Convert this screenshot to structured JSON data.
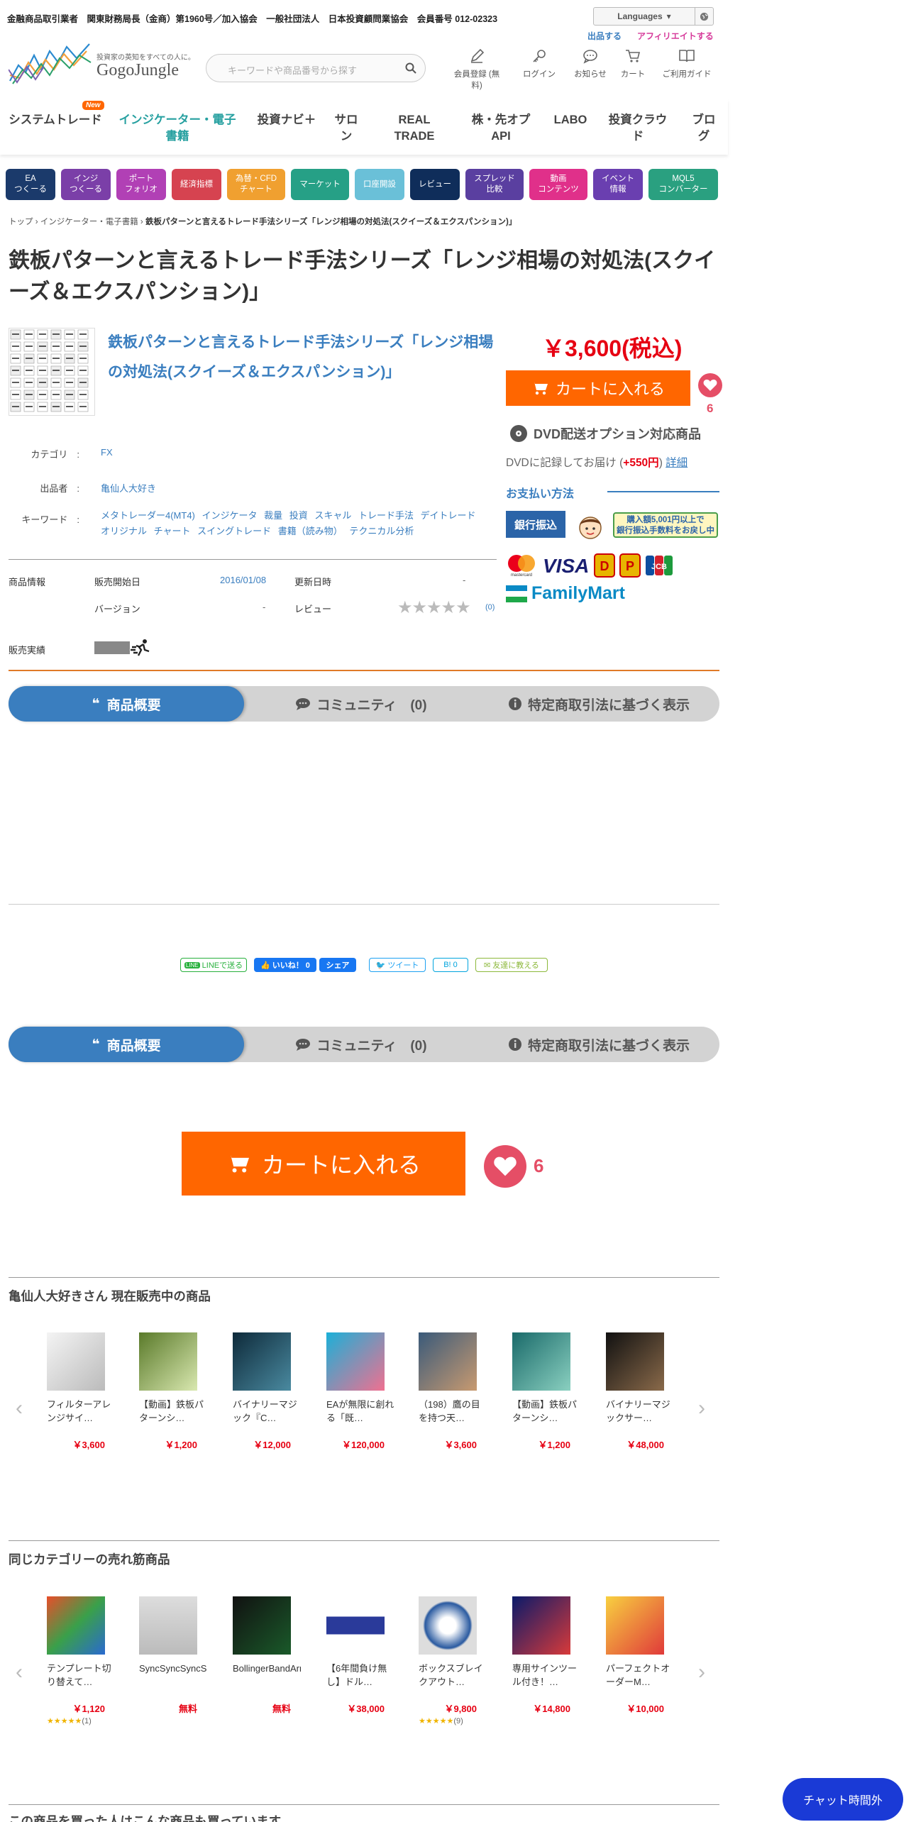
{
  "header": {
    "info": "金融商品取引業者　関東財務局長（金商）第1960号／加入協会　一般社団法人　日本投資顧問業協会　会員番号 012-02323",
    "languages": "Languages",
    "sell_link": "出品する",
    "affiliate_link": "アフィリエイトする",
    "logo_tagline": "投資家の英知をすべての人に。",
    "logo_name": "GogoJungle",
    "search_placeholder": "キーワードや商品番号から探す",
    "icons": [
      {
        "label": "会員登録 (無料)",
        "icon": "pencil-icon"
      },
      {
        "label": "ログイン",
        "icon": "key-icon"
      },
      {
        "label": "お知らせ",
        "icon": "chat-bubble-icon"
      },
      {
        "label": "カート",
        "icon": "cart-icon"
      },
      {
        "label": "ご利用ガイド",
        "icon": "book-icon"
      }
    ]
  },
  "nav": {
    "items": [
      "システムトレード",
      "インジケーター・電子書籍",
      "投資ナビ＋",
      "サロン",
      "REAL TRADE",
      "株・先オプAPI",
      "LABO",
      "投資クラウド",
      "ブログ"
    ],
    "new_badge": "New"
  },
  "quick": {
    "items": [
      {
        "label": "EA\nつくーる",
        "color": "#1b3a6b"
      },
      {
        "label": "インジ\nつくーる",
        "color": "#7b3fa8"
      },
      {
        "label": "ポート\nフォリオ",
        "color": "#b140b5"
      },
      {
        "label": "経済指標",
        "color": "#d64350"
      },
      {
        "label": "為替・CFD\nチャート",
        "color": "#f0a030"
      },
      {
        "label": "マーケット",
        "color": "#26a086"
      },
      {
        "label": "口座開設",
        "color": "#6ac0d8"
      },
      {
        "label": "レビュー",
        "color": "#0f2d5a"
      },
      {
        "label": "スプレッド\n比較",
        "color": "#5a3fa0"
      },
      {
        "label": "動画\nコンテンツ",
        "color": "#e0308a"
      },
      {
        "label": "イベント\n情報",
        "color": "#6a3fb0"
      },
      {
        "label": "MQL5\nコンバーター",
        "color": "#2aa080"
      }
    ]
  },
  "breadcrumb": {
    "top": "トップ",
    "cat": "インジケーター・電子書籍",
    "current": "鉄板パターンと言えるトレード手法シリーズ「レンジ相場の対処法(スクイーズ＆エクスパンション)」"
  },
  "product": {
    "title": "鉄板パターンと言えるトレード手法シリーズ「レンジ相場の対処法(スクイーズ＆エクスパンション)」",
    "subtitle": "鉄板パターンと言えるトレード手法シリーズ「レンジ相場の対処法(スクイーズ＆エクスパンション)」",
    "price": "￥3,600(税込)",
    "cart_label": "カートに入れる",
    "likes": "6",
    "dvd_title": "DVD配送オプション対応商品",
    "dvd_prefix": "DVDに記録してお届け (",
    "dvd_price": "+550円",
    "dvd_suffix": ") ",
    "dvd_detail": "詳細",
    "pay_heading": "お支払い方法",
    "bank": "銀行振込",
    "bank_refund_1": "購入額5,001円以上で",
    "bank_refund_2": "銀行振込手数料をお戻し中",
    "familymart": "FamilyMart",
    "category_label": "カテゴリ",
    "category": "FX",
    "seller_label": "出品者",
    "seller": "亀仙人大好き",
    "keyword_label": "キーワード",
    "keywords": "メタトレーダー4(MT4)  インジケータ  裁量  投資  スキャル  トレード手法  デイトレード  オリジナル  チャート  スイングトレード  書籍（読み物）  テクニカル分析",
    "info_label": "商品情報",
    "release_label": "販売開始日",
    "release": "2016/01/08",
    "update_label": "更新日時",
    "update": "-",
    "version_label": "バージョン",
    "version": "-",
    "review_label": "レビュー",
    "review_count": "(0)",
    "rating": 0,
    "sales_label": "販売実績"
  },
  "tabs": {
    "overview": "商品概要",
    "community": "コミュニティ　(0)",
    "legal": "特定商取引法に基づく表示"
  },
  "share": {
    "line": "LINEで送る",
    "like": "いいね！ 0",
    "share": "シェア",
    "tweet": "ツイート",
    "hatena": "B! 0",
    "mail": "友達に教える"
  },
  "seller_section": {
    "title": "亀仙人大好きさん 現在販売中の商品",
    "items": [
      {
        "name": "フィルターアレンジサイ…",
        "price": "￥3,600"
      },
      {
        "name": "【動画】鉄板パターンシ…",
        "price": "￥1,200"
      },
      {
        "name": "バイナリーマジック『C…",
        "price": "￥12,000"
      },
      {
        "name": "EAが無限に創れる「既…",
        "price": "￥120,000"
      },
      {
        "name": "（198）鷹の目を持つ天…",
        "price": "￥3,600"
      },
      {
        "name": "【動画】鉄板パターンシ…",
        "price": "￥1,200"
      },
      {
        "name": "バイナリーマジックサー…",
        "price": "￥48,000"
      }
    ]
  },
  "category_section": {
    "title": "同じカテゴリーの売れ筋商品",
    "items": [
      {
        "name": "テンプレート切り替えて…",
        "price": "￥1,120",
        "stars": "★★★★★",
        "count": "(1)"
      },
      {
        "name": "SyncSyncSyncSample",
        "price": "無料",
        "stars": "",
        "count": ""
      },
      {
        "name": "BollingerBandArrow",
        "price": "無料",
        "stars": "",
        "count": ""
      },
      {
        "name": "【6年間負け無し】ドル…",
        "price": "￥38,000",
        "stars": "",
        "count": ""
      },
      {
        "name": "ボックスブレイクアウト…",
        "price": "￥9,800",
        "stars": "★★★★★",
        "count": "(9)"
      },
      {
        "name": "専用サインツール付き！…",
        "price": "￥14,800",
        "stars": "",
        "count": ""
      },
      {
        "name": "パーフェクトオーダーM…",
        "price": "￥10,000",
        "stars": "",
        "count": ""
      }
    ]
  },
  "also_bought": {
    "title": "この商品を買った人はこんな商品も買っています"
  },
  "chat": {
    "label": "チャット時間外"
  }
}
